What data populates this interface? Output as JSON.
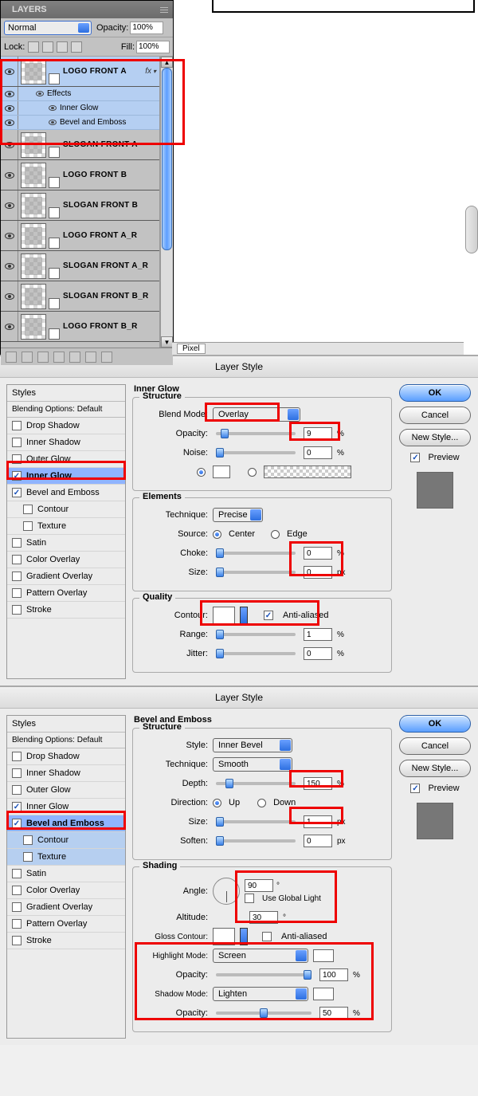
{
  "layersPanel": {
    "title": "LAYERS",
    "blendMode": "Normal",
    "opacityLabel": "Opacity:",
    "opacity": "100%",
    "lockLabel": "Lock:",
    "fillLabel": "Fill:",
    "fill": "100%",
    "layers": [
      {
        "name": "LOGO FRONT A",
        "selected": true,
        "hasFx": true
      },
      {
        "name": "SLOGAN FRONT A"
      },
      {
        "name": "LOGO FRONT B"
      },
      {
        "name": "SLOGAN FRONT B"
      },
      {
        "name": "LOGO FRONT A_R"
      },
      {
        "name": "SLOGAN FRONT A_R"
      },
      {
        "name": "SLOGAN FRONT B_R"
      },
      {
        "name": "LOGO FRONT B_R"
      }
    ],
    "effects": {
      "header": "Effects",
      "items": [
        "Inner Glow",
        "Bevel and Emboss"
      ]
    }
  },
  "canvas": {
    "zoomUnit": "Pixel"
  },
  "dialog": {
    "title": "Layer Style",
    "sidebar": {
      "stylesHeader": "Styles",
      "blendingHeader": "Blending Options: Default",
      "items": [
        "Drop Shadow",
        "Inner Shadow",
        "Outer Glow",
        "Inner Glow",
        "Bevel and Emboss",
        "Contour",
        "Texture",
        "Satin",
        "Color Overlay",
        "Gradient Overlay",
        "Pattern Overlay",
        "Stroke"
      ]
    },
    "buttons": {
      "ok": "OK",
      "cancel": "Cancel",
      "newStyle": "New Style...",
      "preview": "Preview"
    }
  },
  "innerGlow": {
    "title": "Inner Glow",
    "structure": {
      "legend": "Structure",
      "blendModeLabel": "Blend Mode:",
      "blendMode": "Overlay",
      "opacityLabel": "Opacity:",
      "opacity": "9",
      "noiseLabel": "Noise:",
      "noise": "0",
      "pct": "%"
    },
    "elements": {
      "legend": "Elements",
      "techniqueLabel": "Technique:",
      "technique": "Precise",
      "sourceLabel": "Source:",
      "center": "Center",
      "edge": "Edge",
      "chokeLabel": "Choke:",
      "choke": "0",
      "sizeLabel": "Size:",
      "size": "0",
      "px": "px",
      "pct": "%"
    },
    "quality": {
      "legend": "Quality",
      "contourLabel": "Contour:",
      "antiAliased": "Anti-aliased",
      "rangeLabel": "Range:",
      "range": "1",
      "jitterLabel": "Jitter:",
      "jitter": "0",
      "pct": "%"
    }
  },
  "bevel": {
    "title": "Bevel and Emboss",
    "structure": {
      "legend": "Structure",
      "styleLabel": "Style:",
      "style": "Inner Bevel",
      "techniqueLabel": "Technique:",
      "technique": "Smooth",
      "depthLabel": "Depth:",
      "depth": "150",
      "directionLabel": "Direction:",
      "up": "Up",
      "down": "Down",
      "sizeLabel": "Size:",
      "size": "1",
      "softenLabel": "Soften:",
      "soften": "0",
      "px": "px",
      "pct": "%"
    },
    "shading": {
      "legend": "Shading",
      "angleLabel": "Angle:",
      "angle": "90",
      "useGlobal": "Use Global Light",
      "altitudeLabel": "Altitude:",
      "altitude": "30",
      "deg": "°",
      "glossLabel": "Gloss Contour:",
      "antiAliased": "Anti-aliased",
      "highlightLabel": "Highlight Mode:",
      "highlightMode": "Screen",
      "opacityLabel": "Opacity:",
      "highlightOpacity": "100",
      "shadowLabel": "Shadow Mode:",
      "shadowMode": "Lighten",
      "shadowOpacity": "50",
      "pct": "%"
    }
  }
}
